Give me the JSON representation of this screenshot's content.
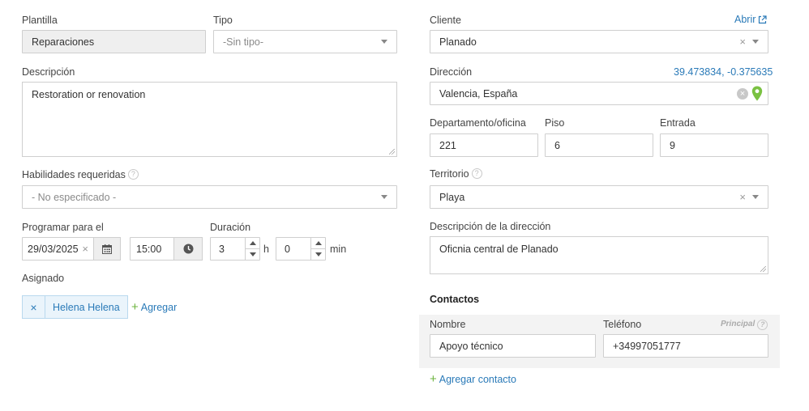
{
  "template": {
    "label": "Plantilla",
    "value": "Reparaciones"
  },
  "type": {
    "label": "Tipo",
    "placeholder": "-Sin tipo-"
  },
  "description": {
    "label": "Descripción",
    "value": "Restoration or renovation"
  },
  "skills": {
    "label": "Habilidades requeridas",
    "placeholder": "- No especificado -"
  },
  "schedule": {
    "label": "Programar para el",
    "date": "29/03/2025",
    "time": "15:00"
  },
  "duration": {
    "label": "Duración",
    "hours": "3",
    "hours_unit": "h",
    "minutes": "0",
    "minutes_unit": "min"
  },
  "assigned": {
    "label": "Asignado",
    "remove": "×",
    "users": [
      "Helena Helena"
    ],
    "add_label": "Agregar"
  },
  "client": {
    "label": "Cliente",
    "open_label": "Abrir",
    "value": "Planado"
  },
  "address": {
    "label": "Dirección",
    "coordinates": "39.473834, -0.375635",
    "value": "Valencia, España"
  },
  "department": {
    "label": "Departamento/oficina",
    "value": "221"
  },
  "floor": {
    "label": "Piso",
    "value": "6"
  },
  "entrance": {
    "label": "Entrada",
    "value": "9"
  },
  "territory": {
    "label": "Territorio",
    "value": "Playa"
  },
  "address_description": {
    "label": "Descripción de la dirección",
    "value": "Oficnia central de Planado"
  },
  "contacts": {
    "title": "Contactos",
    "name_label": "Nombre",
    "phone_label": "Teléfono",
    "principal_label": "Principal",
    "items": [
      {
        "name": "Apoyo técnico",
        "phone": "+34997051777"
      }
    ],
    "add_label": "Agregar contacto"
  },
  "colors": {
    "accent": "#2a7ab8",
    "green": "#6cb33e",
    "pin": "#7ac142",
    "readonly_bg": "#efefef"
  },
  "icons": {
    "clear": "×",
    "help": "?",
    "plus": "+"
  }
}
